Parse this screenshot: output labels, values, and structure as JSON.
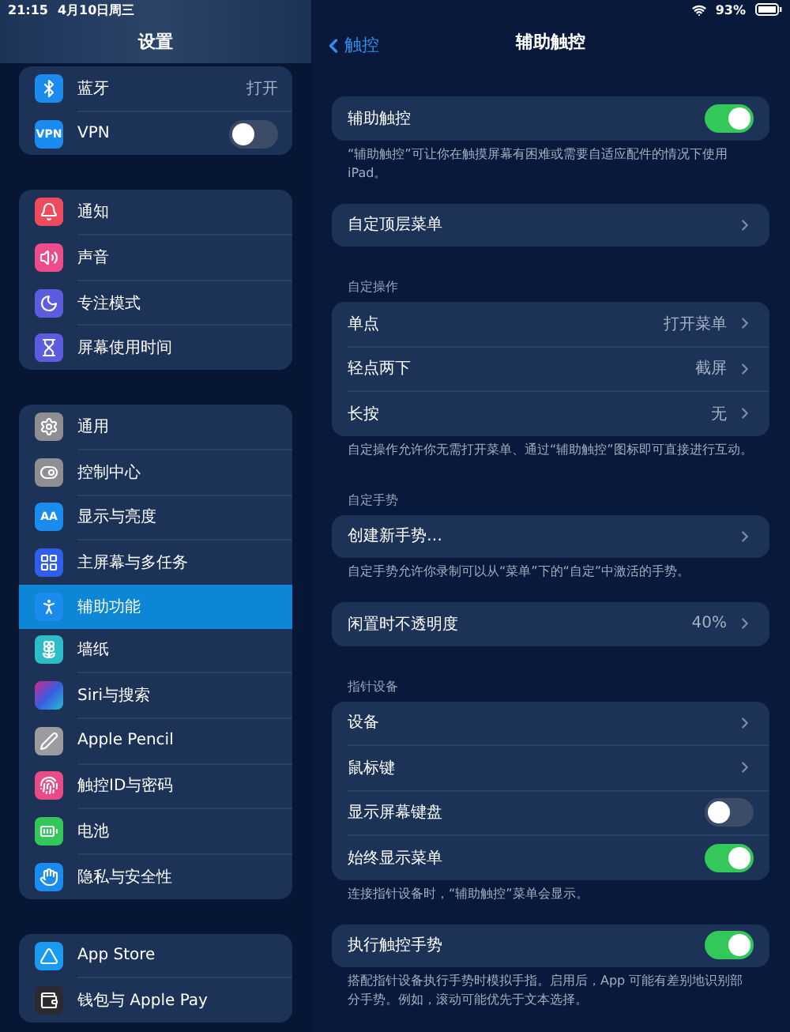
{
  "status_bar": {
    "time": "21:15",
    "date": "4月10日周三",
    "battery": "93%"
  },
  "sidebar": {
    "title": "设置",
    "groups": [
      {
        "items": [
          {
            "label": "蓝牙",
            "kind": "value",
            "value": "打开",
            "selected": false
          },
          {
            "label": "VPN",
            "kind": "toggle",
            "on": false,
            "icon_text": "VPN",
            "selected": false
          }
        ]
      },
      {
        "items": [
          {
            "label": "通知",
            "kind": "plain",
            "selected": false
          },
          {
            "label": "声音",
            "kind": "plain",
            "selected": false
          },
          {
            "label": "专注模式",
            "kind": "plain",
            "selected": false
          },
          {
            "label": "屏幕使用时间",
            "kind": "plain",
            "selected": false
          }
        ]
      },
      {
        "items": [
          {
            "label": "通用",
            "kind": "plain",
            "selected": false
          },
          {
            "label": "控制中心",
            "kind": "plain",
            "selected": false
          },
          {
            "label": "显示与亮度",
            "kind": "plain",
            "icon_text": "AA",
            "selected": false
          },
          {
            "label": "主屏幕与多任务",
            "kind": "plain",
            "selected": false
          },
          {
            "label": "辅助功能",
            "kind": "plain",
            "selected": true
          },
          {
            "label": "墙纸",
            "kind": "plain",
            "selected": false
          },
          {
            "label": "Siri与搜索",
            "kind": "plain",
            "selected": false
          },
          {
            "label": "Apple Pencil",
            "kind": "plain",
            "selected": false
          },
          {
            "label": "触控ID与密码",
            "kind": "plain",
            "selected": false
          },
          {
            "label": "电池",
            "kind": "plain",
            "selected": false
          },
          {
            "label": "隐私与安全性",
            "kind": "plain",
            "selected": false
          }
        ]
      },
      {
        "items": [
          {
            "label": "App Store",
            "kind": "plain",
            "selected": false
          },
          {
            "label": "钱包与 Apple Pay",
            "kind": "plain",
            "selected": false
          }
        ]
      }
    ]
  },
  "detail": {
    "back": "触控",
    "title": "辅助触控",
    "sections": [
      {
        "rows": [
          {
            "label": "辅助触控",
            "kind": "toggle",
            "on": true
          }
        ],
        "footer": "“辅助触控”可让你在触摸屏幕有困难或需要自适应配件的情况下使用 iPad。"
      },
      {
        "rows": [
          {
            "label": "自定顶层菜单",
            "kind": "link"
          }
        ]
      },
      {
        "header": "自定操作",
        "rows": [
          {
            "label": "单点",
            "kind": "link",
            "value": "打开菜单"
          },
          {
            "label": "轻点两下",
            "kind": "link",
            "value": "截屏"
          },
          {
            "label": "长按",
            "kind": "link",
            "value": "无"
          }
        ],
        "footer": "自定操作允许你无需打开菜单、通过“辅助触控”图标即可直接进行互动。"
      },
      {
        "header": "自定手势",
        "rows": [
          {
            "label": "创建新手势…",
            "kind": "link"
          }
        ],
        "footer": "自定手势允许你录制可以从“菜单”下的“自定”中激活的手势。"
      },
      {
        "rows": [
          {
            "label": "闲置时不透明度",
            "kind": "link",
            "value": "40%"
          }
        ]
      },
      {
        "header": "指针设备",
        "rows": [
          {
            "label": "设备",
            "kind": "link"
          },
          {
            "label": "鼠标键",
            "kind": "link"
          },
          {
            "label": "显示屏幕键盘",
            "kind": "toggle",
            "on": false
          },
          {
            "label": "始终显示菜单",
            "kind": "toggle",
            "on": true
          }
        ],
        "footer": "连接指针设备时，“辅助触控”菜单会显示。"
      },
      {
        "rows": [
          {
            "label": "执行触控手势",
            "kind": "toggle",
            "on": true
          }
        ],
        "footer": "搭配指针设备执行手势时模拟手指。启用后，App 可能有差别地识别部分手势。例如，滚动可能优先于文本选择。"
      }
    ]
  }
}
